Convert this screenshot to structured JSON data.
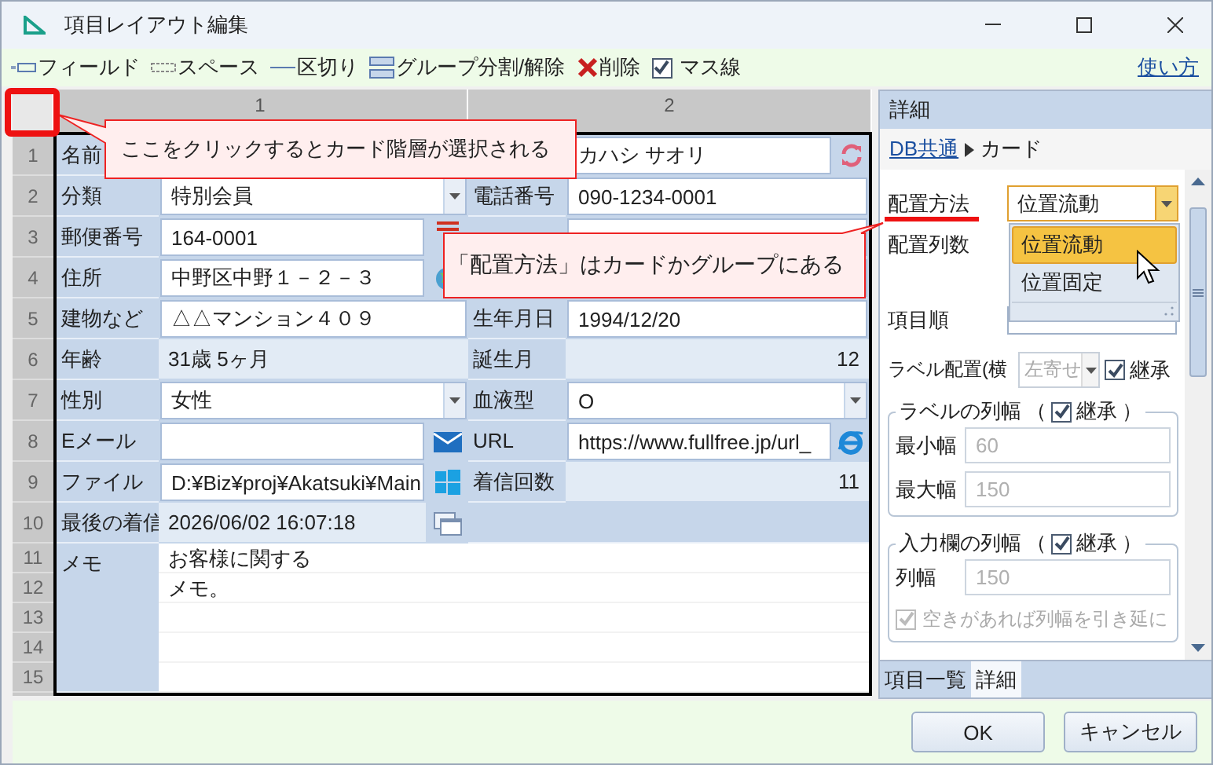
{
  "window": {
    "title": "項目レイアウト編集"
  },
  "toolbar": {
    "items": [
      {
        "kind": "field",
        "label": "フィールド"
      },
      {
        "kind": "space",
        "label": "スペース"
      },
      {
        "kind": "separator",
        "label": "区切り"
      },
      {
        "kind": "group",
        "label": "グループ分割/解除"
      },
      {
        "kind": "delete",
        "label": "削除"
      },
      {
        "kind": "checkbox",
        "label": "マス線",
        "checked": true
      }
    ],
    "help_link": "使い方"
  },
  "grid": {
    "column_headers": [
      "1",
      "2"
    ],
    "row_numbers": [
      "1",
      "2",
      "3",
      "4",
      "5",
      "6",
      "7",
      "8",
      "9",
      "10",
      "11",
      "12",
      "13",
      "14",
      "15"
    ],
    "rows": [
      {
        "left": {
          "label": "名前",
          "kind": "input"
        },
        "right": {
          "kind": "input",
          "value": "カハシ サオリ"
        }
      },
      {
        "left": {
          "label": "分類",
          "kind": "select",
          "value": "特別会員"
        },
        "right": {
          "label": "電話番号",
          "kind": "input",
          "value": "090-1234-0001"
        }
      },
      {
        "left": {
          "label": "郵便番号",
          "kind": "input",
          "value": "164-0001"
        },
        "right": {
          "kind": "input"
        }
      },
      {
        "left": {
          "label": "住所",
          "kind": "input",
          "value": "中野区中野１－２－３"
        },
        "right": {
          "kind": "input"
        }
      },
      {
        "left": {
          "label": "建物など",
          "kind": "input",
          "value": "△△マンション４０９"
        },
        "right": {
          "label": "生年月日",
          "kind": "input",
          "value": "1994/12/20"
        }
      },
      {
        "left": {
          "label": "年齢",
          "kind": "readonly",
          "value": "31歳 5ヶ月"
        },
        "right": {
          "label": "誕生月",
          "kind": "number",
          "value": "12"
        }
      },
      {
        "left": {
          "label": "性別",
          "kind": "select",
          "value": "女性"
        },
        "right": {
          "label": "血液型",
          "kind": "select",
          "value": "O"
        }
      },
      {
        "left": {
          "label": "Eメール",
          "kind": "input"
        },
        "right": {
          "label": "URL",
          "kind": "input",
          "value": "https://www.fullfree.jp/url_"
        }
      },
      {
        "left": {
          "label": "ファイル",
          "kind": "input",
          "value": "D:¥Biz¥proj¥Akatsuki¥Main"
        },
        "right": {
          "label": "着信回数",
          "kind": "number",
          "value": "11"
        }
      },
      {
        "left": {
          "label": "最後の着信",
          "kind": "readonly",
          "value": "2026/06/02 16:07:18"
        },
        "right": {
          "kind": "empty"
        }
      }
    ],
    "memo": {
      "label": "メモ",
      "lines": [
        "お客様に関する",
        "メモ。"
      ]
    }
  },
  "callouts": [
    {
      "text": "ここをクリックするとカード階層が選択される"
    },
    {
      "text": "「配置方法」はカードかグループにある"
    }
  ],
  "detail": {
    "title": "詳細",
    "breadcrumb": {
      "link": "DB共通",
      "current": "カード"
    },
    "placement": {
      "label": "配置方法",
      "value": "位置流動",
      "options": [
        {
          "label": "位置流動",
          "selected": true
        },
        {
          "label": "位置固定",
          "selected": false
        }
      ]
    },
    "columns_label": "配置列数",
    "order_label": "項目順",
    "label_align": {
      "label": "ラベル配置(横",
      "value": "左寄せ",
      "disabled": true,
      "inherit_label": "継承",
      "inherit": true
    },
    "label_width": {
      "title": "ラベルの列幅",
      "paren_open": "（",
      "paren_close": "）",
      "inherit_label": "継承",
      "inherit": true,
      "fields": [
        {
          "label": "最小幅",
          "value": "60",
          "disabled": true
        },
        {
          "label": "最大幅",
          "value": "150",
          "disabled": true
        }
      ]
    },
    "input_width": {
      "title": "入力欄の列幅",
      "paren_open": "（",
      "paren_close": "）",
      "inherit_label": "継承",
      "inherit": true,
      "fields": [
        {
          "label": "列幅",
          "value": "150",
          "disabled": true
        }
      ],
      "stretch": {
        "label": "空きがあれば列幅を引き延に",
        "checked": true,
        "disabled": true
      }
    }
  },
  "tabs": [
    {
      "label": "項目一覧",
      "selected": false
    },
    {
      "label": "詳細",
      "selected": true
    }
  ],
  "buttons": [
    "OK",
    "キャンセル"
  ]
}
